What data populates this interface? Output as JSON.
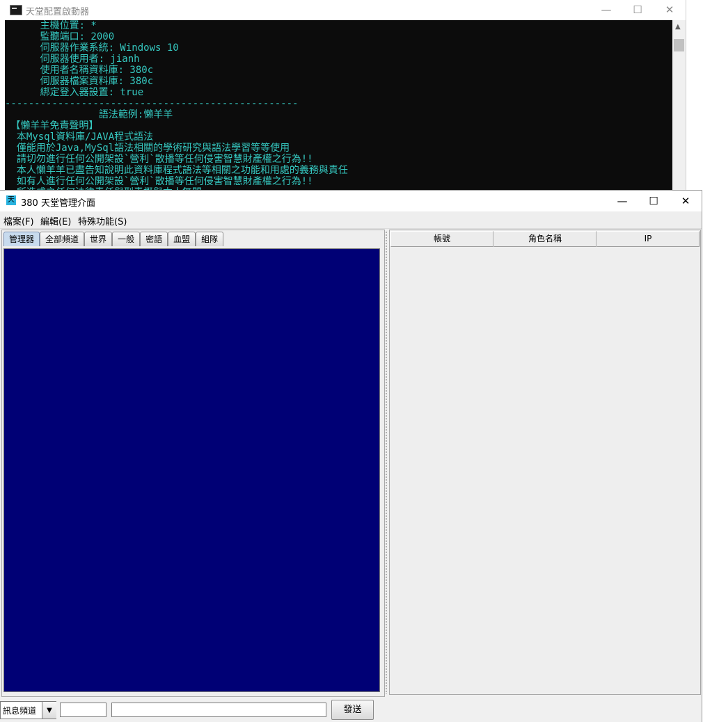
{
  "console": {
    "title": "天堂配置啟動器",
    "icon": "console-icon",
    "controls": {
      "minimize": "—",
      "maximize": "☐",
      "close": "✕"
    },
    "lines": [
      "      主機位置: *",
      "      監聽端口: 2000",
      "      伺服器作業系統: Windows 10",
      "      伺服器使用者: jianh",
      "      使用者名稱資料庫: 380c",
      "      伺服器檔案資料庫: 380c",
      "      綁定登入器設置: true",
      "--------------------------------------------------",
      "                語法範例:懶羊羊",
      " 【懶羊羊免責聲明】",
      "  本Mysql資料庫/JAVA程式語法",
      "  僅能用於Java,MySql語法相關的學術研究與語法學習等等使用",
      "  請切勿進行任何公開架設`營利`散播等任何侵害智慧財產權之行為!!",
      "  本人懶羊羊已盡告知說明此資料庫程式語法等相關之功能和用處的義務與責任",
      "  如有人進行任何公開架設`營利`散播等任何侵害智慧財產權之行為!!",
      "  所造成之任何法律責任與刑責概與本人無關"
    ],
    "colors": {
      "background": "#0c0c0c",
      "text": "#35c8c0"
    }
  },
  "manager": {
    "icon_char": "天",
    "title": "380 天堂管理介面",
    "controls": {
      "minimize": "—",
      "maximize": "☐",
      "close": "✕"
    },
    "menus": [
      "檔案(F)",
      "編輯(E)",
      "特殊功能(S)"
    ],
    "tabs": [
      "管理器",
      "全部頻道",
      "世界",
      "一般",
      "密語",
      "血盟",
      "組隊"
    ],
    "active_tab": "管理器",
    "table_columns": [
      "帳號",
      "角色名稱",
      "IP"
    ],
    "channel_combo": {
      "value": "訊息頻道",
      "arrow": "▼"
    },
    "send_label": "發送",
    "colors": {
      "chat_background": "#000075",
      "window": "#f0f0f0"
    }
  }
}
